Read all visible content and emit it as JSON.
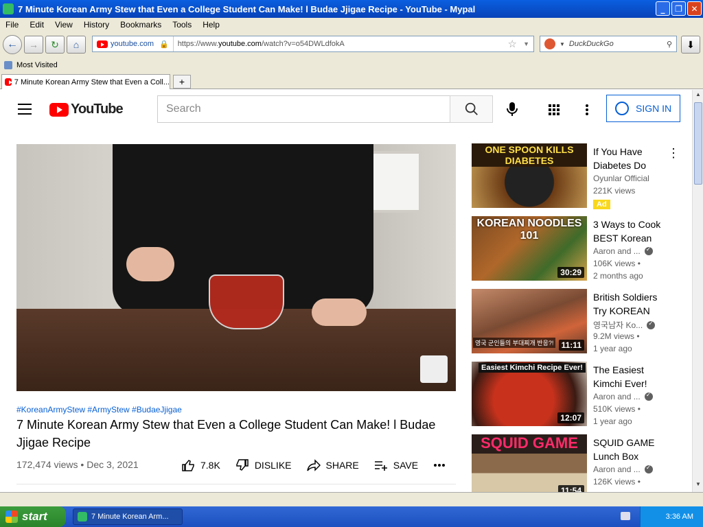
{
  "window": {
    "title": "7 Minute Korean Army Stew that Even a College Student Can Make! l Budae Jjigae Recipe - YouTube - Mypal",
    "controls": {
      "minimize": "_",
      "maximize": "❐",
      "close": "✕"
    }
  },
  "menu": [
    "File",
    "Edit",
    "View",
    "History",
    "Bookmarks",
    "Tools",
    "Help"
  ],
  "navbar": {
    "site_label": "youtube.com",
    "url_prefix": "https://www.",
    "url_domain": "youtube.com",
    "url_path": "/watch?v=o54DWLdfokA",
    "search_placeholder": "DuckDuckGo"
  },
  "bookmarks": {
    "most_visited": "Most Visited"
  },
  "tabs": [
    {
      "label": "7 Minute Korean Army Stew that Even a Coll..."
    }
  ],
  "youtube": {
    "logo_text": "YouTube",
    "search_placeholder": "Search",
    "signin_label": "SIGN IN"
  },
  "video": {
    "hashtags": "#KoreanArmyStew #ArmyStew #BudaeJjigae",
    "title": "7 Minute Korean Army Stew that Even a College Student Can Make! l Budae Jjigae Recipe",
    "views": "172,474 views",
    "date": "Dec 3, 2021",
    "likes": "7.8K",
    "dislike_label": "DISLIKE",
    "share_label": "SHARE",
    "save_label": "SAVE"
  },
  "recommendations": [
    {
      "thumb_caption": "ONE SPOON KILLS DIABETES",
      "thumb_color": "#5a3412",
      "caption_color": "#ffe04a",
      "title": "If You Have Diabetes Do",
      "channel": "Oyunlar Official",
      "line2": "221K views",
      "badge": "Ad",
      "verified": false,
      "duration": ""
    },
    {
      "thumb_caption": "KOREAN NOODLES 101",
      "thumb_color": "#6d3f1f",
      "caption_color": "#ffffff",
      "title": "3 Ways to Cook BEST Korean",
      "channel": "Aaron and ...",
      "line2": "106K views •",
      "line3": "2 months ago",
      "verified": true,
      "duration": "30:29"
    },
    {
      "thumb_caption": "",
      "thumb_color": "#8a5a3c",
      "caption_color": "#ffffff",
      "subcaption": "영국 군인들의 부대찌개 반응?!",
      "title": "British Soldiers Try KOREAN",
      "channel": "영국남자 Ko...",
      "line2": "9.2M views •",
      "line3": "1 year ago",
      "verified": true,
      "duration": "11:11"
    },
    {
      "thumb_caption": "Easiest Kimchi Recipe Ever!",
      "thumb_color": "#7a1f12",
      "caption_color": "#ffffff",
      "title": "The Easiest Kimchi Ever!",
      "channel": "Aaron and ...",
      "line2": "510K views •",
      "line3": "1 year ago",
      "verified": true,
      "duration": "12:07"
    },
    {
      "thumb_caption": "SQUID GAME",
      "thumb_color": "#3a2a24",
      "caption_color": "#ff2a6a",
      "title": "SQUID GAME Lunch Box",
      "channel": "Aaron and ...",
      "line2": "126K views •",
      "verified": true,
      "duration": "11:54"
    }
  ],
  "taskbar": {
    "start_label": "start",
    "task_label": "7 Minute Korean Arm...",
    "clock": "3:36 AM"
  }
}
